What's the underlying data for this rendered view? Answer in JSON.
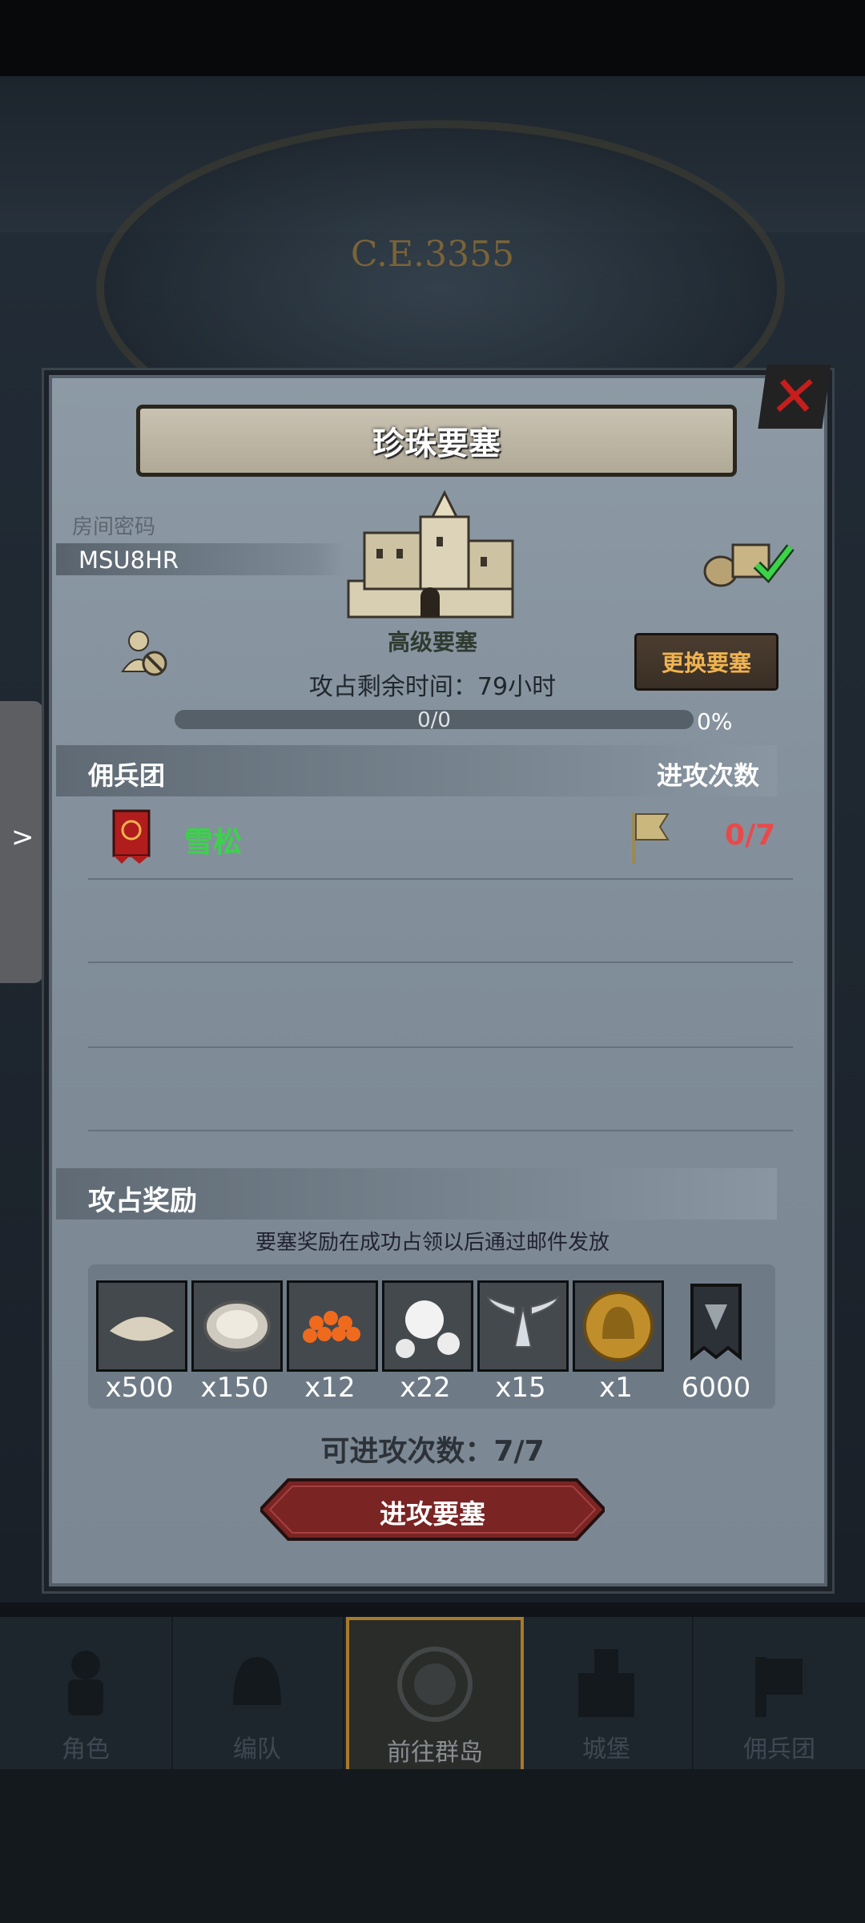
{
  "background": {
    "era": "C.E.3355"
  },
  "panel": {
    "title": "珍珠要塞",
    "room_label": "房间密码",
    "room_code": "MSU8HR",
    "fortress_type": "高级要塞",
    "switch_button": "更换要塞",
    "timer_text": "攻占剩余时间：79小时",
    "progress": {
      "text": "0/0",
      "percent": "0%"
    },
    "mercenary_header": "佣兵团",
    "attack_header": "进攻次数",
    "guild": {
      "name": "雪松",
      "attacks": "0/7"
    },
    "rewards": {
      "header": "攻占奖励",
      "note": "要塞奖励在成功占领以后通过邮件发放",
      "items": [
        {
          "icon": "sand-icon",
          "count": "x500"
        },
        {
          "icon": "oyster-icon",
          "count": "x150"
        },
        {
          "icon": "fish-roe-icon",
          "count": "x12"
        },
        {
          "icon": "pearl-icon",
          "count": "x22"
        },
        {
          "icon": "silver-wings-icon",
          "count": "x15"
        },
        {
          "icon": "gold-helmet-coin-icon",
          "count": "x1"
        },
        {
          "icon": "guild-banner-icon",
          "count": "6000"
        }
      ]
    },
    "attacks_left": "可进攻次数：7/7",
    "attack_button": "进攻要塞"
  },
  "nav": {
    "items": [
      {
        "label": "角色",
        "icon": "knight-icon"
      },
      {
        "label": "编队",
        "icon": "helmet-icon"
      },
      {
        "label": "前往群岛",
        "icon": "compass-map-icon",
        "active": true
      },
      {
        "label": "城堡",
        "icon": "castle-icon"
      },
      {
        "label": "佣兵团",
        "icon": "mercenary-banner-icon"
      }
    ]
  },
  "colors": {
    "accent_gold": "#f0b350",
    "guild_green": "#3bd34a",
    "count_red": "#e84a4a",
    "close_red": "#c61d1d"
  }
}
